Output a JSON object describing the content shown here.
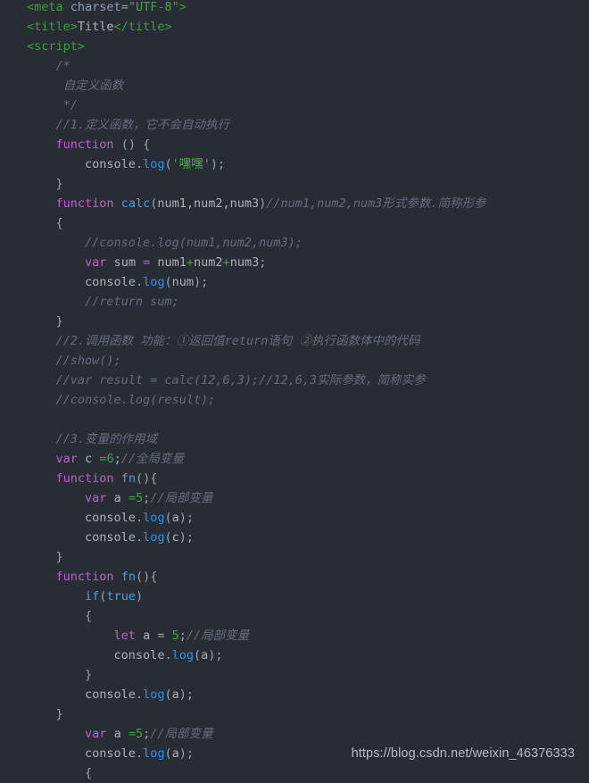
{
  "editor": {
    "background_color": "#282c34",
    "default_text_color": "#abb2bf",
    "lines": [
      "<meta charset=\"UTF-8\">",
      "<title>Title</title>",
      "<script>",
      "    /*",
      "     自定义函数",
      "     */",
      "    //1.定义函数，它不会自动执行",
      "    function () {",
      "        console.log('嘿嘿');",
      "    }",
      "    function calc(num1,num2,num3)//num1,num2,num3形式参数.简称形参",
      "    {",
      "        //console.log(num1,num2,num3);",
      "        var sum = num1+num2+num3;",
      "        console.log(num);",
      "        //return sum;",
      "    }",
      "    //2.调用函数 功能：①返回值return语句 ②执行函数体中的代码",
      "    //show();",
      "    //var result = calc(12,6,3);//12,6,3实际参数，简称实参",
      "    //console.log(result);",
      "",
      "    //3.变量的作用域",
      "    var c =6;//全局变量",
      "    function fn(){",
      "        var a =5;//局部变量",
      "        console.log(a);",
      "        console.log(c);",
      "    }",
      "    function fn(){",
      "        if(true)",
      "        {",
      "            let a = 5;//局部变量",
      "            console.log(a);",
      "        }",
      "        console.log(a);",
      "    }",
      "        var a =5;//局部变量",
      "        console.log(a);",
      "        {"
    ]
  },
  "watermark": {
    "url": "https://blog.csdn.net/weixin_46376333"
  }
}
